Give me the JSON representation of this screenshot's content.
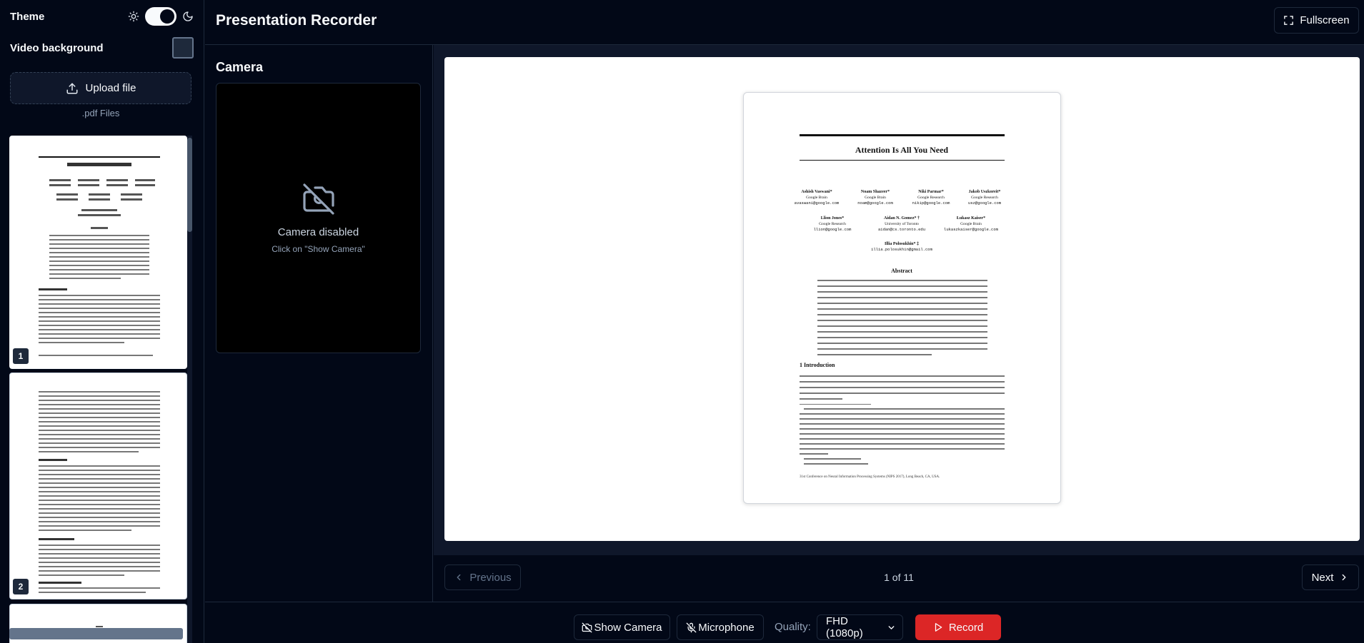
{
  "sidebar": {
    "theme_label": "Theme",
    "theme_toggle_on": true,
    "video_background_label": "Video background",
    "video_background_checked": false,
    "upload_label": "Upload file",
    "upload_note": ".pdf Files",
    "thumbnails": [
      {
        "number": "1"
      },
      {
        "number": "2"
      }
    ]
  },
  "header": {
    "title": "Presentation Recorder",
    "fullscreen_label": "Fullscreen"
  },
  "camera": {
    "title": "Camera",
    "status": "Camera disabled",
    "hint": "Click on \"Show Camera\""
  },
  "slide": {
    "paper_title": "Attention Is All You Need",
    "authors_row1": [
      {
        "name": "Ashish Vaswani*",
        "org": "Google Brain",
        "email": "avaswani@google.com"
      },
      {
        "name": "Noam Shazeer*",
        "org": "Google Brain",
        "email": "noam@google.com"
      },
      {
        "name": "Niki Parmar*",
        "org": "Google Research",
        "email": "nikip@google.com"
      },
      {
        "name": "Jakob Uszkoreit*",
        "org": "Google Research",
        "email": "usz@google.com"
      }
    ],
    "authors_row2": [
      {
        "name": "Llion Jones*",
        "org": "Google Research",
        "email": "llion@google.com"
      },
      {
        "name": "Aidan N. Gomez* †",
        "org": "University of Toronto",
        "email": "aidan@cs.toronto.edu"
      },
      {
        "name": "Łukasz Kaiser*",
        "org": "Google Brain",
        "email": "lukaszkaiser@google.com"
      }
    ],
    "author_last": {
      "name": "Illia Polosukhin* ‡",
      "email": "illia.polosukhin@gmail.com"
    },
    "abstract_heading": "Abstract",
    "section_heading": "1   Introduction",
    "footer_text": "31st Conference on Neural Information Processing Systems (NIPS 2017), Long Beach, CA, USA."
  },
  "navigation": {
    "previous_label": "Previous",
    "page_count": "1 of 11",
    "next_label": "Next"
  },
  "controls": {
    "show_camera_label": "Show Camera",
    "microphone_label": "Microphone",
    "quality_label": "Quality:",
    "quality_value": "FHD (1080p)",
    "record_label": "Record"
  },
  "colors": {
    "background": "#020817",
    "border": "#1e293b",
    "record": "#dc2626"
  }
}
